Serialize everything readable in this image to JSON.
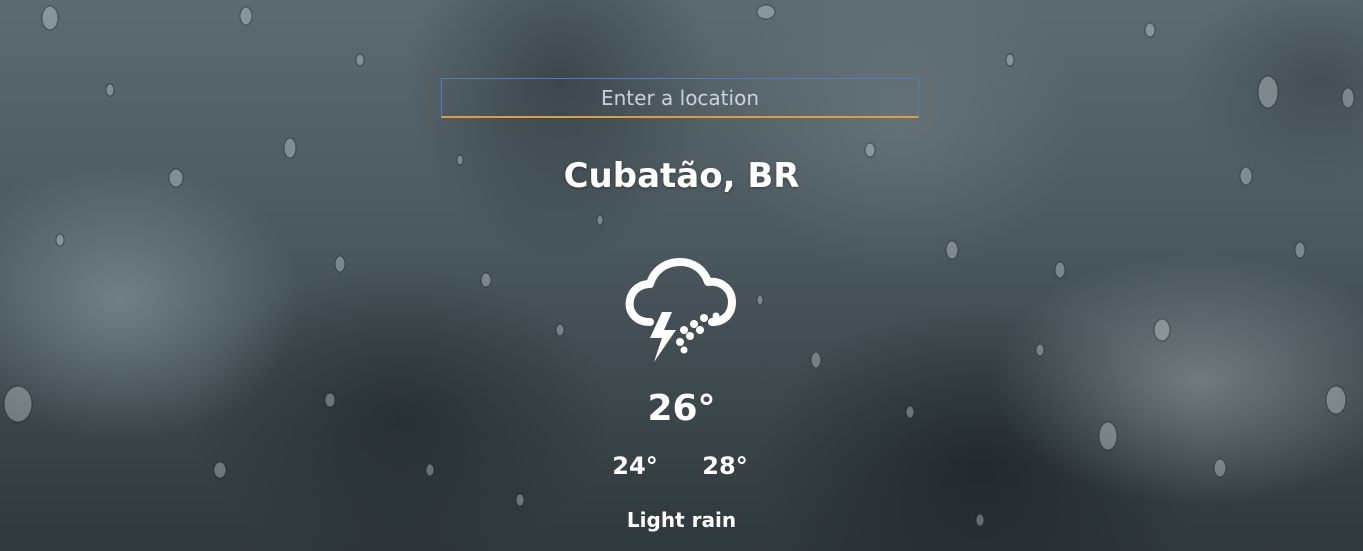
{
  "search": {
    "placeholder": "Enter a location",
    "value": ""
  },
  "location": {
    "city": "Cubatão, BR"
  },
  "weather": {
    "icon": "thunder-rain-icon",
    "temperature": "26°",
    "low": "24°",
    "high": "28°",
    "condition": "Light rain"
  },
  "colors": {
    "search_border": "#4f7fbf",
    "search_underline": "#d6a04a",
    "text": "#ffffff"
  }
}
